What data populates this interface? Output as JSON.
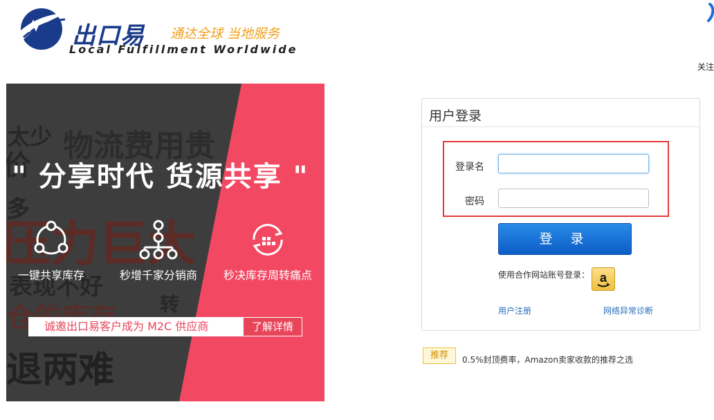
{
  "header": {
    "brand_name": "出口易",
    "slogan": "通达全球 当地服务",
    "brand_english": "Local Fulfillment Worldwide",
    "follow_label": "关注"
  },
  "banner": {
    "bg_words": [
      "太少",
      "物流费用贵",
      "价",
      "多",
      "压力巨大",
      "表现不好",
      "仓的库存",
      "退两难",
      "转"
    ],
    "headline": "\" 分享时代  货源共享 \"",
    "features": [
      {
        "label": "一键共享库存",
        "icon": "share-network-icon"
      },
      {
        "label": "秒增千家分销商",
        "icon": "hierarchy-icon"
      },
      {
        "label": "秒决库存周转痛点",
        "icon": "inventory-cycle-icon"
      }
    ],
    "cta_text": "诚邀出口易客户成为 M2C 供应商",
    "cta_button": "了解详情",
    "colors": {
      "accent": "#f24862",
      "dark": "#3a3a3a"
    }
  },
  "login": {
    "title": "用户登录",
    "username_label": "登录名",
    "username_value": "",
    "password_label": "密码",
    "password_value": "",
    "submit_label": "登 录",
    "partner_text": "使用合作网站账号登录：",
    "partner_icon": "amazon-icon",
    "register_link": "用户注册",
    "diagnose_link": "网络异常诊断",
    "colors": {
      "button": "#1068d4",
      "highlight_border": "#e53935"
    }
  },
  "recommend": {
    "badge": "推荐",
    "text": "0.5%封顶费率，Amazon卖家收款的推荐之选"
  }
}
